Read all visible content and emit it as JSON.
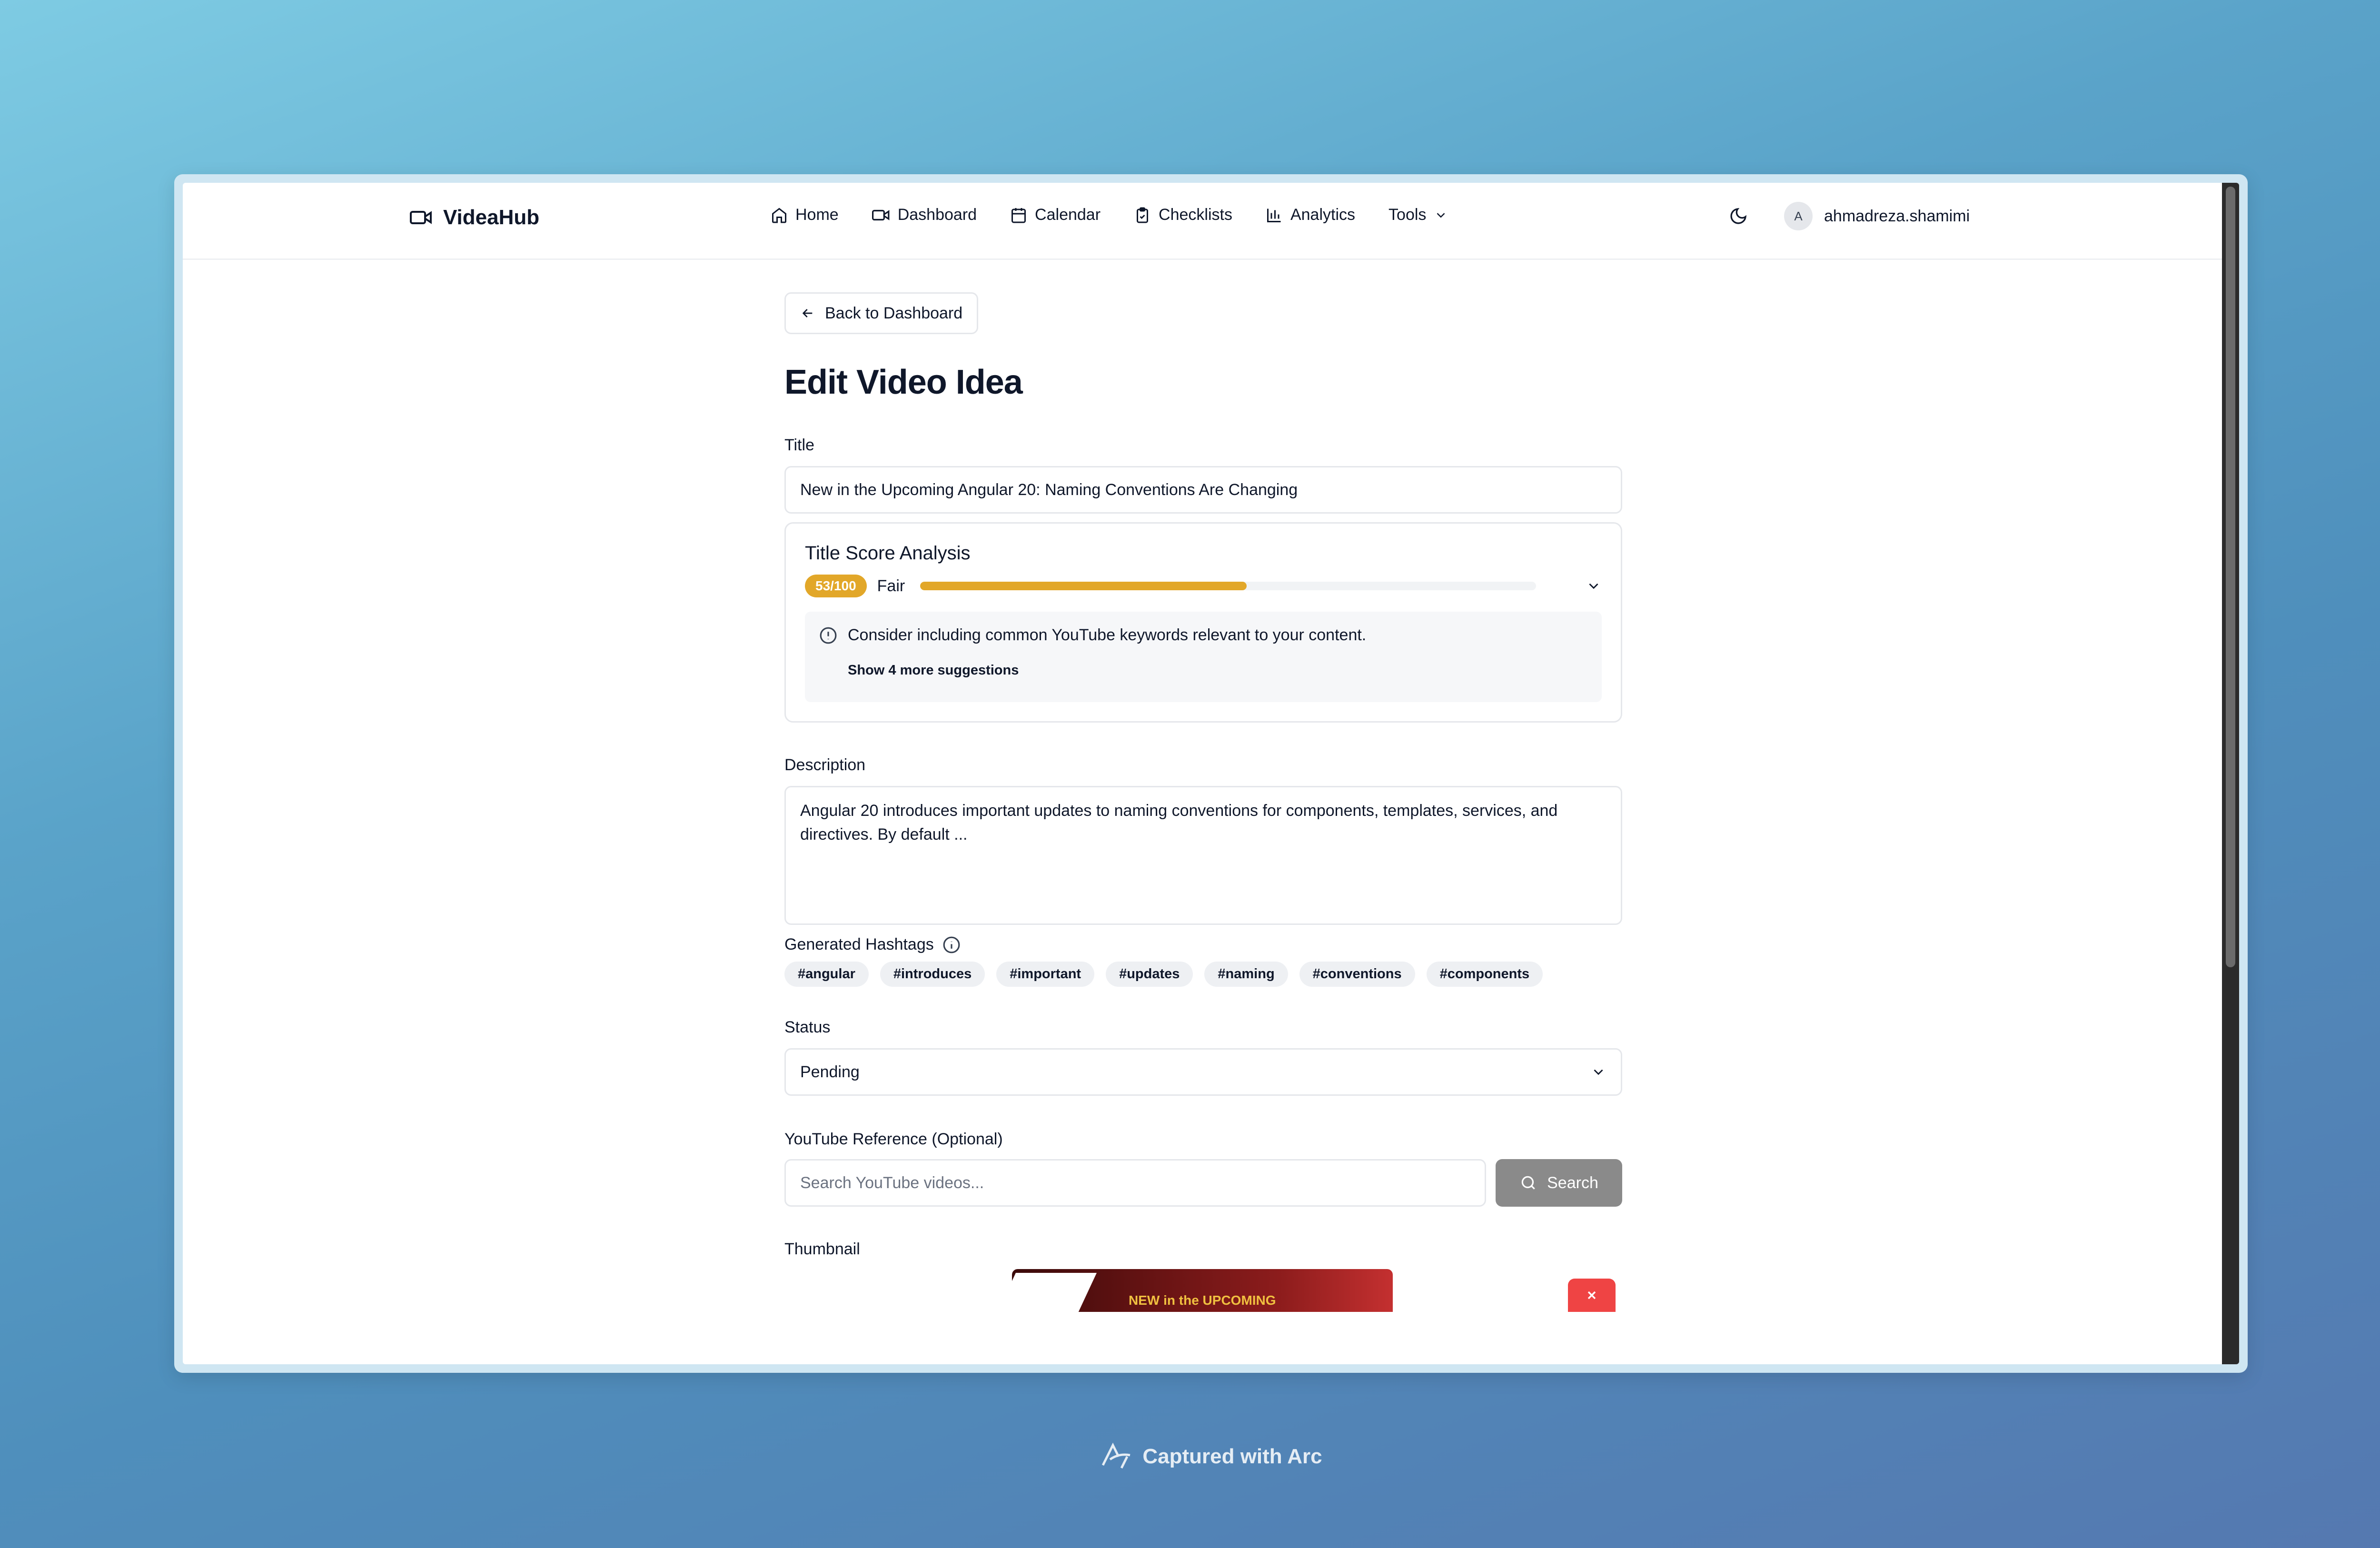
{
  "app": {
    "name": "VideaHub"
  },
  "nav": {
    "items": [
      {
        "label": "Home",
        "icon": "home-icon"
      },
      {
        "label": "Dashboard",
        "icon": "video-icon"
      },
      {
        "label": "Calendar",
        "icon": "calendar-icon"
      },
      {
        "label": "Checklists",
        "icon": "clipboard-icon"
      },
      {
        "label": "Analytics",
        "icon": "bar-chart-icon"
      },
      {
        "label": "Tools",
        "icon": "chevron-down-icon"
      }
    ],
    "user": {
      "initial": "A",
      "name": "ahmadreza.shamimi"
    }
  },
  "page": {
    "back_label": "Back to Dashboard",
    "heading": "Edit Video Idea"
  },
  "form": {
    "title_label": "Title",
    "title_value": "New in the Upcoming Angular 20: Naming Conventions Are Changing",
    "score": {
      "heading": "Title Score Analysis",
      "badge": "53/100",
      "rating": "Fair",
      "progress": 0.53,
      "suggestion": "Consider including common YouTube keywords relevant to your content.",
      "more_label": "Show 4 more suggestions"
    },
    "description_label": "Description",
    "description_value": "Angular 20 introduces important updates to naming conventions for components, templates, services, and directives. By default ...",
    "hashtags_label": "Generated Hashtags",
    "hashtags": [
      "#angular",
      "#introduces",
      "#important",
      "#updates",
      "#naming",
      "#conventions",
      "#components"
    ],
    "status_label": "Status",
    "status_value": "Pending",
    "youtube_label": "YouTube Reference (Optional)",
    "youtube_placeholder": "Search YouTube videos...",
    "search_label": "Search",
    "thumbnail_label": "Thumbnail",
    "thumbnail_text": "NEW in the UPCOMING"
  },
  "footer": {
    "text": "Captured with Arc"
  },
  "colors": {
    "accent": "#e2a729",
    "danger": "#ef4444",
    "button_gray": "#8a8a8a"
  }
}
